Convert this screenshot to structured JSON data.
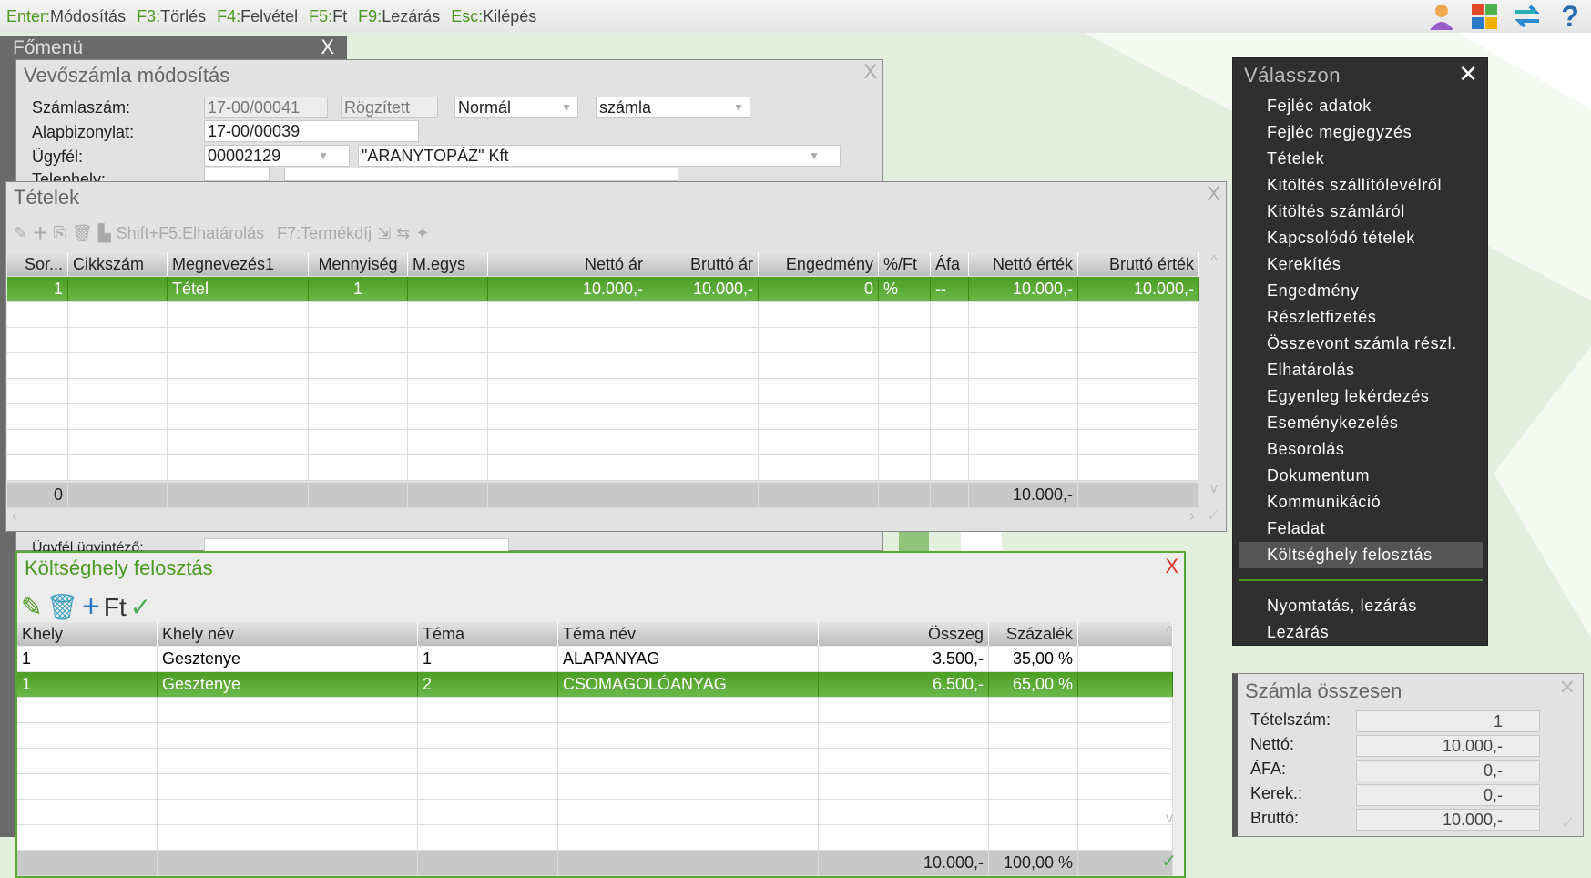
{
  "topbar": {
    "commands": [
      {
        "key": "Enter:",
        "label": "Módosítás"
      },
      {
        "key": "F3:",
        "label": "Törlés"
      },
      {
        "key": "F4:",
        "label": "Felvétel"
      },
      {
        "key": "F5:",
        "label": "Ft"
      },
      {
        "key": "F9:",
        "label": "Lezárás"
      },
      {
        "key": "Esc:",
        "label": "Kilépés"
      }
    ],
    "icons": [
      "user-icon",
      "tiles-icon",
      "swap-icon",
      "help-icon"
    ]
  },
  "main_menu": {
    "title": "Főmenü",
    "close": "X"
  },
  "invoice": {
    "title": "Vevőszámla módosítás",
    "close": "X",
    "labels": {
      "number": "Számlaszám:",
      "base": "Alapbizonylat:",
      "client": "Ügyfél:",
      "site": "Telephely:",
      "agent": "Ügyfél ügyintéző:"
    },
    "number": "17-00/00041",
    "status": "Rögzített",
    "type": "Normál",
    "kind": "számla",
    "base": "17-00/00039",
    "client_code": "00002129",
    "client_name": "\"ARANYTOPÁZ\" Kft"
  },
  "items": {
    "title": "Tételek",
    "close": "X",
    "toolbar": {
      "shift_f5": "Shift+F5:Elhatárolás",
      "f7": "F7:Termékdíj"
    },
    "columns": [
      "Sor...",
      "Cikkszám",
      "Megnevezés1",
      "Mennyiség",
      "M.egys",
      "Nettó ár",
      "Bruttó ár",
      "Engedmény",
      "%/Ft",
      "Áfa",
      "Nettó érték",
      "Bruttó érték"
    ],
    "rows": [
      [
        "1",
        "",
        "Tétel",
        "1",
        "",
        "10.000,-",
        "10.000,-",
        "0",
        "%",
        "--",
        "10.000,-",
        "10.000,-"
      ]
    ],
    "footer": [
      "0",
      "",
      "",
      "",
      "",
      "",
      "",
      "",
      "",
      "",
      "10.000,-",
      ""
    ]
  },
  "cost": {
    "title": "Költséghely felosztás",
    "close": "X",
    "toolbar": {
      "ft": "Ft"
    },
    "columns": [
      "Khely",
      "Khely név",
      "Téma",
      "Téma név",
      "Összeg",
      "Százalék",
      ""
    ],
    "rows": [
      [
        "1",
        "Gesztenye",
        "1",
        "ALAPANYAG",
        "3.500,-",
        "35,00 %",
        ""
      ],
      [
        "1",
        "Gesztenye",
        "2",
        "CSOMAGOLÓANYAG",
        "6.500,-",
        "65,00 %",
        ""
      ]
    ],
    "footer": [
      "",
      "",
      "",
      "",
      "10.000,-",
      "100,00 %",
      ""
    ]
  },
  "choose": {
    "title": "Válasszon",
    "close": "✕",
    "items": [
      "Fejléc adatok",
      "Fejléc megjegyzés",
      "Tételek",
      "Kitöltés szállítólevélről",
      "Kitöltés számláról",
      "Kapcsolódó tételek",
      "Kerekítés",
      "Engedmény",
      "Részletfizetés",
      "Összevont számla részl.",
      "Elhatárolás",
      "Egyenleg lekérdezés",
      "Eseménykezelés",
      "Besorolás",
      "Dokumentum",
      "Kommunikáció",
      "Feladat",
      "Költséghely felosztás"
    ],
    "highlighted": "Költséghely felosztás",
    "bottom_items": [
      "Nyomtatás, lezárás",
      "Lezárás"
    ]
  },
  "totals": {
    "title": "Számla összesen",
    "close": "✕",
    "rows": [
      {
        "label": "Tételszám:",
        "value": "1"
      },
      {
        "label": "Nettó:",
        "value": "10.000,-"
      },
      {
        "label": "ÁFA:",
        "value": "0,-"
      },
      {
        "label": "Kerek.:",
        "value": "0,-"
      },
      {
        "label": "Bruttó:",
        "value": "10.000,-"
      }
    ]
  },
  "colors": {
    "accent": "#4a9a1f",
    "selected_row": "#5aa832",
    "menu_bg": "#2f2f2f"
  }
}
